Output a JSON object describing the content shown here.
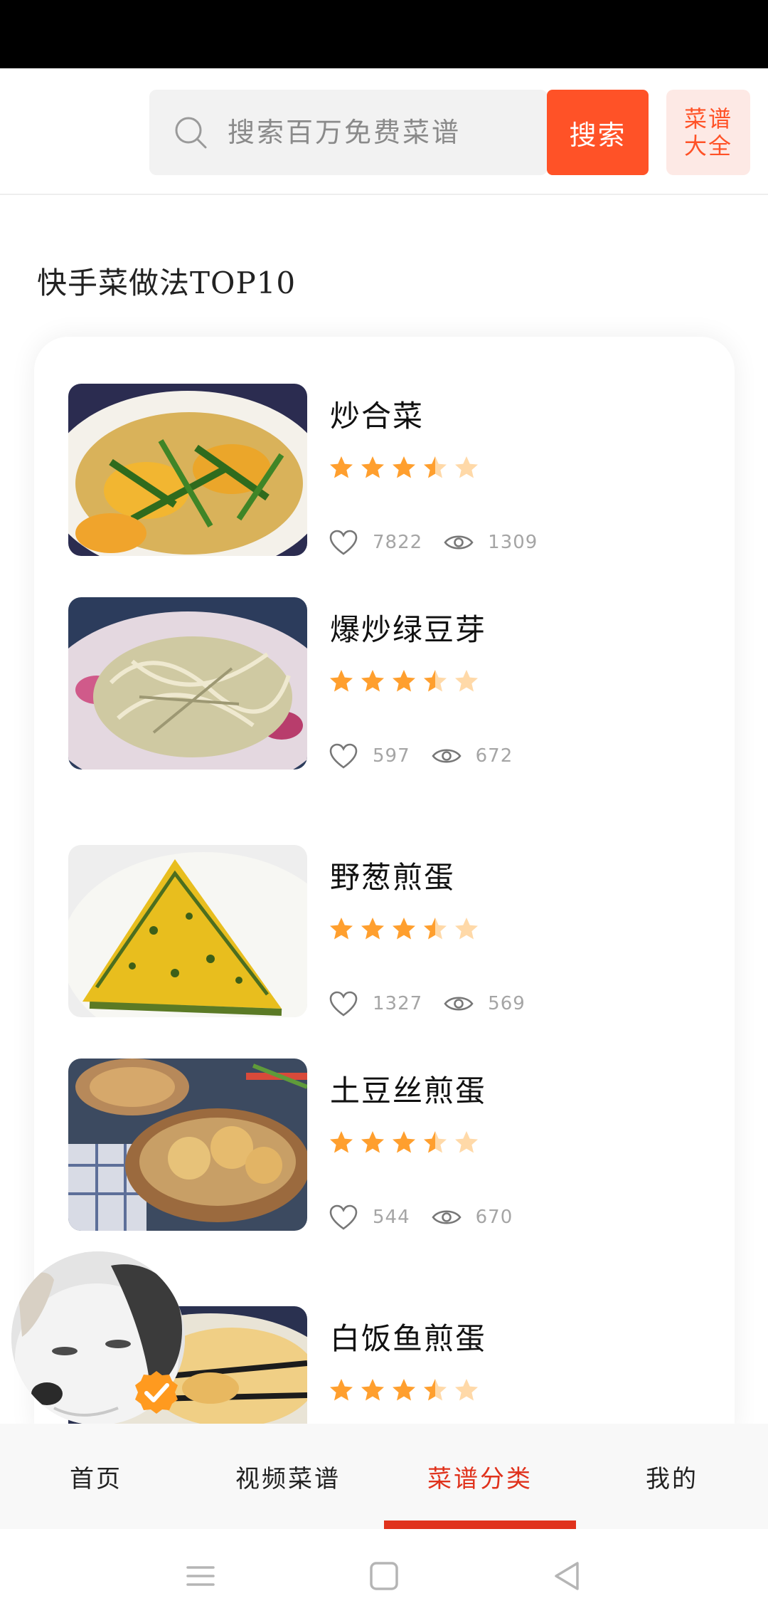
{
  "search": {
    "placeholder": "搜索百万免费菜谱",
    "button_label": "搜索",
    "catalog_line1": "菜谱",
    "catalog_line2": "大全"
  },
  "section": {
    "title": "快手菜做法TOP10"
  },
  "recipes": [
    {
      "name": "炒合菜",
      "rating": 3.5,
      "likes": "7822",
      "views": "1309"
    },
    {
      "name": "爆炒绿豆芽",
      "rating": 3.5,
      "likes": "597",
      "views": "672"
    },
    {
      "name": "野葱煎蛋",
      "rating": 3.5,
      "likes": "1327",
      "views": "569"
    },
    {
      "name": "土豆丝煎蛋",
      "rating": 3.5,
      "likes": "544",
      "views": "670"
    },
    {
      "name": "白饭鱼煎蛋",
      "rating": 3.5
    }
  ],
  "nav": {
    "items": [
      {
        "label": "首页"
      },
      {
        "label": "视频菜谱"
      },
      {
        "label": "菜谱分类"
      },
      {
        "label": "我的"
      }
    ],
    "active_index": 2
  },
  "colors": {
    "accent": "#ff5227",
    "nav_active": "#e0321c",
    "star": "#ff9f2e",
    "star_empty": "#ffd9a8"
  }
}
